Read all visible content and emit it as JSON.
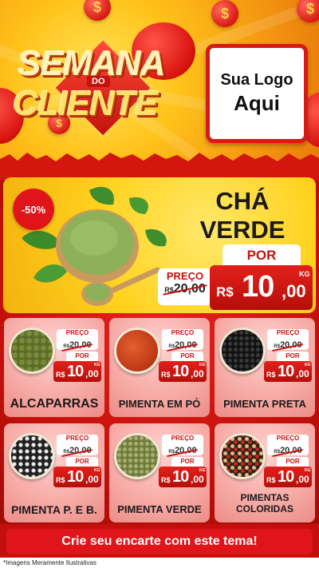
{
  "colors": {
    "brand_red": "#d81a14",
    "brand_yellow": "#ffd21e",
    "white": "#ffffff"
  },
  "header": {
    "title_line1": "SEMANA",
    "title_do": "DO",
    "title_line2": "CLIENTE",
    "logo_line1": "Sua Logo",
    "logo_line2": "Aqui",
    "coin_symbol": "$"
  },
  "feature": {
    "discount": "-50%",
    "name_line1": "CHÁ",
    "name_line2": "VERDE",
    "preco_label": "PREÇO",
    "old_price_currency": "R$",
    "old_price": "20,00",
    "por_label": "POR",
    "currency": "R$",
    "price_int": "10",
    "price_dec": ",00",
    "unit": "KG"
  },
  "products": [
    {
      "name": "ALCAPARRAS",
      "preco_label": "PREÇO",
      "old_currency": "R$",
      "old_price": "20,00",
      "por_label": "POR",
      "currency": "R$",
      "price_int": "10",
      "price_dec": ",00",
      "unit": "KG"
    },
    {
      "name": "PIMENTA EM PÓ",
      "preco_label": "PREÇO",
      "old_currency": "R$",
      "old_price": "20,00",
      "por_label": "POR",
      "currency": "R$",
      "price_int": "10",
      "price_dec": ",00",
      "unit": "KG"
    },
    {
      "name": "PIMENTA PRETA",
      "preco_label": "PREÇO",
      "old_currency": "R$",
      "old_price": "20,00",
      "por_label": "POR",
      "currency": "R$",
      "price_int": "10",
      "price_dec": ",00",
      "unit": "KG"
    },
    {
      "name": "PIMENTA P. E B.",
      "preco_label": "PREÇO",
      "old_currency": "R$",
      "old_price": "20,00",
      "por_label": "POR",
      "currency": "R$",
      "price_int": "10",
      "price_dec": ",00",
      "unit": "KG"
    },
    {
      "name": "PIMENTA VERDE",
      "preco_label": "PREÇO",
      "old_currency": "R$",
      "old_price": "20,00",
      "por_label": "POR",
      "currency": "R$",
      "price_int": "10",
      "price_dec": ",00",
      "unit": "KG"
    },
    {
      "name_line1": "PIMENTAS",
      "name_line2": "COLORIDAS",
      "preco_label": "PREÇO",
      "old_currency": "R$",
      "old_price": "20,00",
      "por_label": "POR",
      "currency": "R$",
      "price_int": "10",
      "price_dec": ",00",
      "unit": "KG"
    }
  ],
  "cta": {
    "label": "Crie seu encarte com este tema!"
  },
  "footer": {
    "disclaimer": "*Imagens Meramente Ilustrativas"
  }
}
